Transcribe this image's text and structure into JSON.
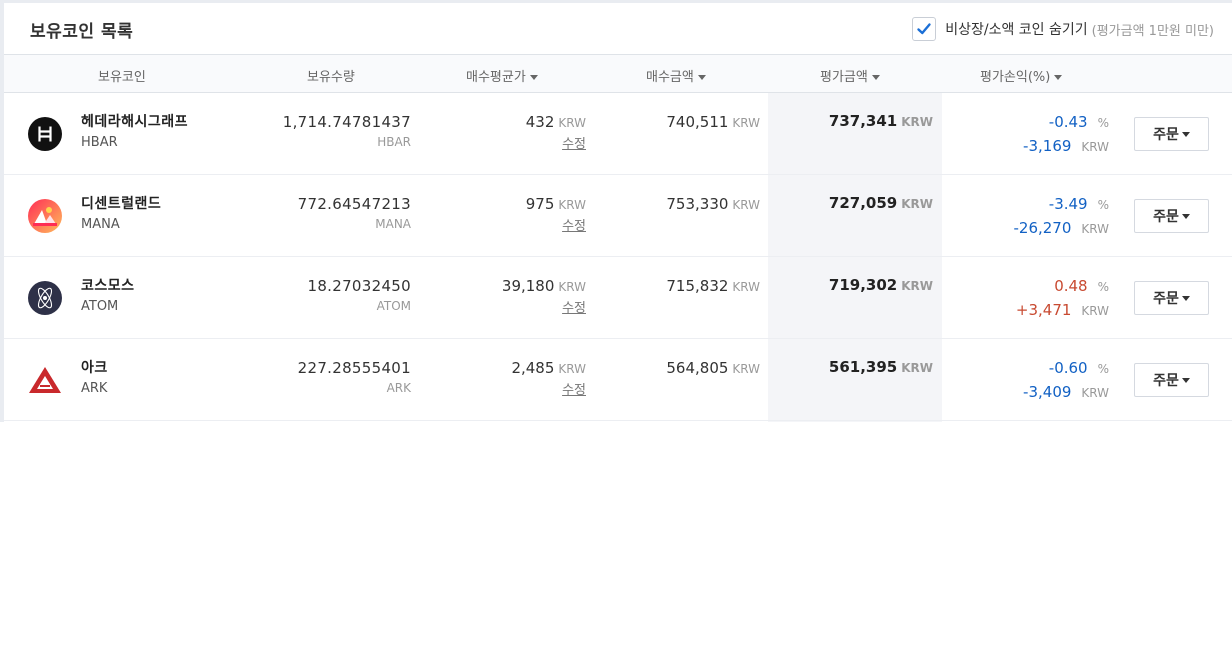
{
  "title": "보유코인 목록",
  "hide_option": {
    "checked": true,
    "label": "비상장/소액 코인 숨기기",
    "note": "(평가금액 1만원 미만)"
  },
  "columns": {
    "coin": "보유코인",
    "quantity": "보유수량",
    "avg_price": "매수평균가",
    "buy_amount": "매수금액",
    "eval_amount": "평가금액",
    "pl_rate": "평가손익(%)"
  },
  "edit_label": "수정",
  "order_label": "주문",
  "currency": "KRW",
  "percent_sign": "%",
  "colors": {
    "negative": "#1261c4",
    "positive": "#c84a31",
    "eval_bg": "#f4f5f8"
  },
  "rows": [
    {
      "name": "헤데라해시그래프",
      "symbol": "HBAR",
      "logo": "hbar-logo",
      "quantity": "1,714.74781437",
      "quantity_unit": "HBAR",
      "avg_price": "432",
      "buy_amount": "740,511",
      "eval_amount": "737,341",
      "pl_rate": "-0.43",
      "pl_amount": "-3,169",
      "trend": "negative"
    },
    {
      "name": "디센트럴랜드",
      "symbol": "MANA",
      "logo": "mana-logo",
      "quantity": "772.64547213",
      "quantity_unit": "MANA",
      "avg_price": "975",
      "buy_amount": "753,330",
      "eval_amount": "727,059",
      "pl_rate": "-3.49",
      "pl_amount": "-26,270",
      "trend": "negative"
    },
    {
      "name": "코스모스",
      "symbol": "ATOM",
      "logo": "atom-logo",
      "quantity": "18.27032450",
      "quantity_unit": "ATOM",
      "avg_price": "39,180",
      "buy_amount": "715,832",
      "eval_amount": "719,302",
      "pl_rate": "0.48",
      "pl_amount": "+3,471",
      "trend": "positive"
    },
    {
      "name": "아크",
      "symbol": "ARK",
      "logo": "ark-logo",
      "quantity": "227.28555401",
      "quantity_unit": "ARK",
      "avg_price": "2,485",
      "buy_amount": "564,805",
      "eval_amount": "561,395",
      "pl_rate": "-0.60",
      "pl_amount": "-3,409",
      "trend": "negative"
    }
  ]
}
